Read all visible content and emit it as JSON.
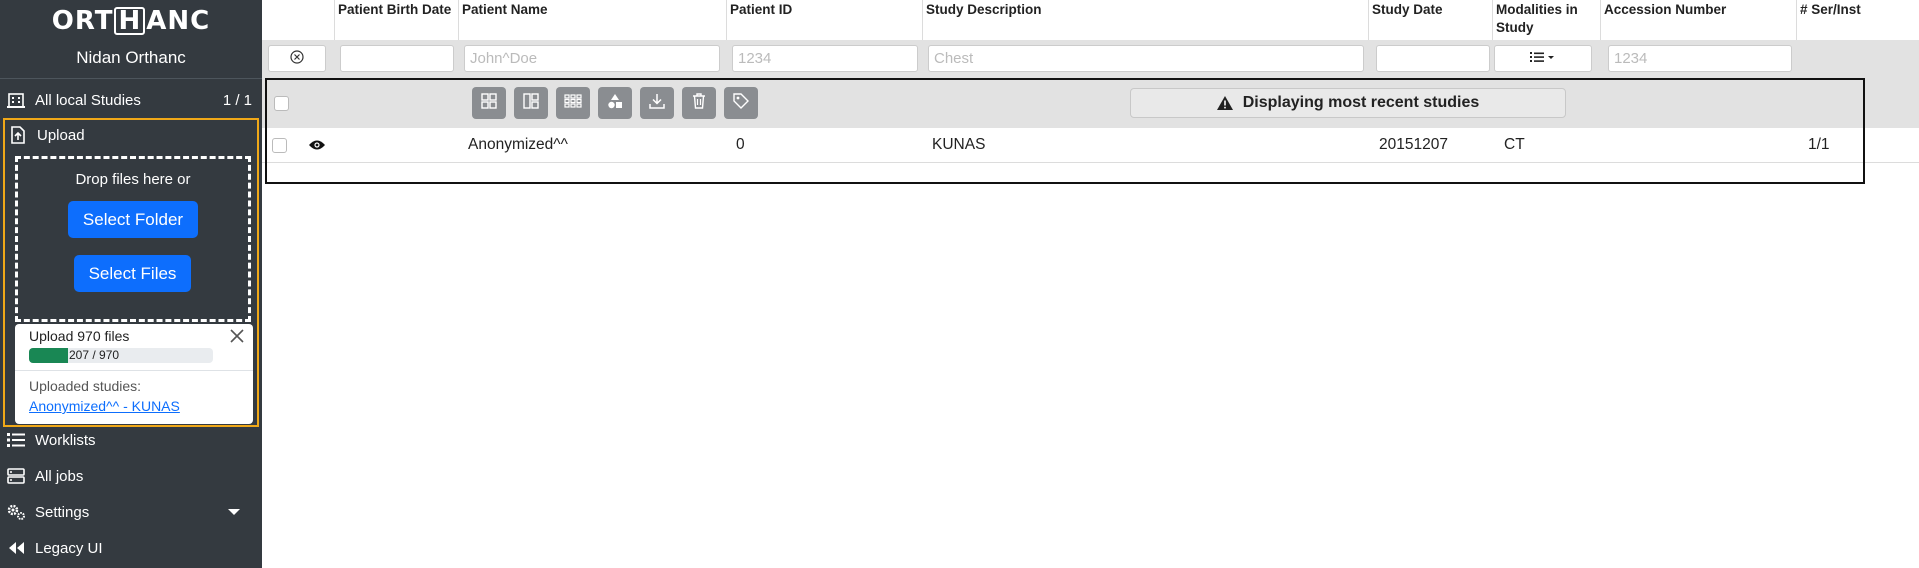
{
  "app": {
    "logo_left": "ORT",
    "logo_mid": "H",
    "logo_right": "ANC",
    "subtitle": "Nidan Orthanc"
  },
  "sidebar": {
    "all_studies": {
      "label": "All local Studies",
      "count": "1 / 1"
    },
    "upload": {
      "label": "Upload",
      "drop_text": "Drop files here or",
      "select_folder": "Select Folder",
      "select_files": "Select Files",
      "status_title": "Upload 970 files",
      "progress_text": "207 / 970",
      "progress_fraction": 0.213,
      "uploaded_label": "Uploaded studies:",
      "uploaded_link": "Anonymized^^ - KUNAS"
    },
    "worklists": "Worklists",
    "all_jobs": "All jobs",
    "settings": "Settings",
    "legacy": "Legacy UI"
  },
  "table": {
    "columns": [
      "Patient Birth Date",
      "Patient Name",
      "Patient ID",
      "Study Description",
      "Study Date",
      "Modalities in Study",
      "Accession Number",
      "# Ser/Inst"
    ],
    "filters": {
      "patient_name_placeholder": "John^Doe",
      "patient_id_placeholder": "1234",
      "study_desc_placeholder": "Chest",
      "accession_placeholder": "1234"
    },
    "banner": "Displaying most recent studies",
    "rows": [
      {
        "patient_name": "Anonymized^^",
        "patient_id": "0",
        "study_description": "KUNAS",
        "study_date": "20151207",
        "modalities": "CT",
        "series_instances": "1/1"
      }
    ]
  },
  "colors": {
    "sidebar_bg": "#343a40",
    "accent_blue": "#0d6efd",
    "upload_border": "#f0a818",
    "progress_green": "#198754"
  }
}
